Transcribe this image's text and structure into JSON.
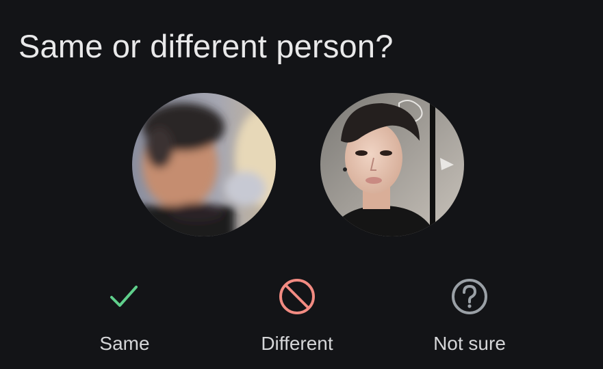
{
  "prompt": {
    "title": "Same or different person?"
  },
  "photos": [
    {
      "name": "left-face-photo",
      "icon": "blurred-face-photo"
    },
    {
      "name": "right-face-photo",
      "icon": "face-photo"
    }
  ],
  "choices": [
    {
      "label": "Same",
      "icon": "checkmark-icon",
      "color": "#5fcf8b"
    },
    {
      "label": "Different",
      "icon": "prohibited-icon",
      "color": "#f28b82"
    },
    {
      "label": "Not sure",
      "icon": "question-circle-icon",
      "color": "#9aa0a6"
    }
  ],
  "colors": {
    "background": "#131417",
    "text": "#e9e9ea"
  }
}
